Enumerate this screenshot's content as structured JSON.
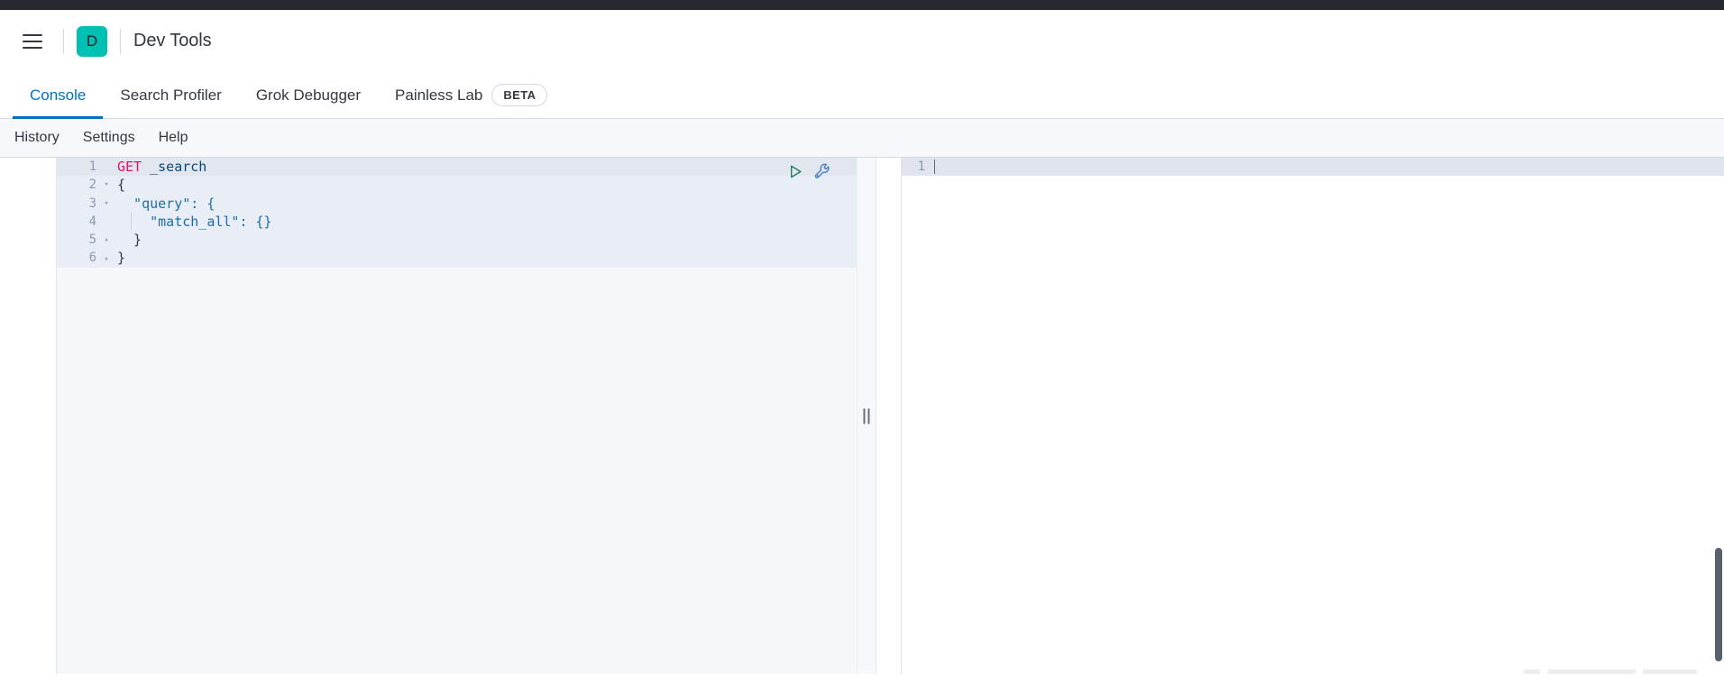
{
  "app": {
    "logo_letter": "D",
    "title": "Dev Tools",
    "menu_icon": "hamburger-menu-icon"
  },
  "tabs": [
    {
      "label": "Console",
      "active": true,
      "badge": null
    },
    {
      "label": "Search Profiler",
      "active": false,
      "badge": null
    },
    {
      "label": "Grok Debugger",
      "active": false,
      "badge": null
    },
    {
      "label": "Painless Lab",
      "active": false,
      "badge": "BETA"
    }
  ],
  "subnav": [
    {
      "label": "History"
    },
    {
      "label": "Settings"
    },
    {
      "label": "Help"
    }
  ],
  "editor": {
    "actions": {
      "play_label": "play-icon",
      "wrench_label": "wrench-icon"
    },
    "lines": [
      {
        "num": "1",
        "fold": "",
        "method": "GET",
        "rest": " _search",
        "type": "request"
      },
      {
        "num": "2",
        "fold": "▾",
        "text": "{",
        "type": "json"
      },
      {
        "num": "3",
        "fold": "▾",
        "text": "  \"query\": {",
        "type": "json"
      },
      {
        "num": "4",
        "fold": "",
        "text": "    \"match_all\": {}",
        "type": "json"
      },
      {
        "num": "5",
        "fold": "▴",
        "text": "  }",
        "type": "json"
      },
      {
        "num": "6",
        "fold": "▴",
        "text": "}",
        "type": "json"
      }
    ]
  },
  "output": {
    "line_number": "1",
    "content": ""
  },
  "colors": {
    "accent": "#0071c2",
    "brand_teal": "#00bfb3",
    "topbar_dark": "#25282f",
    "method_keyword": "#cf1a6d",
    "string_token": "#1b6fa8",
    "page_bg": "#f7f8fc"
  }
}
